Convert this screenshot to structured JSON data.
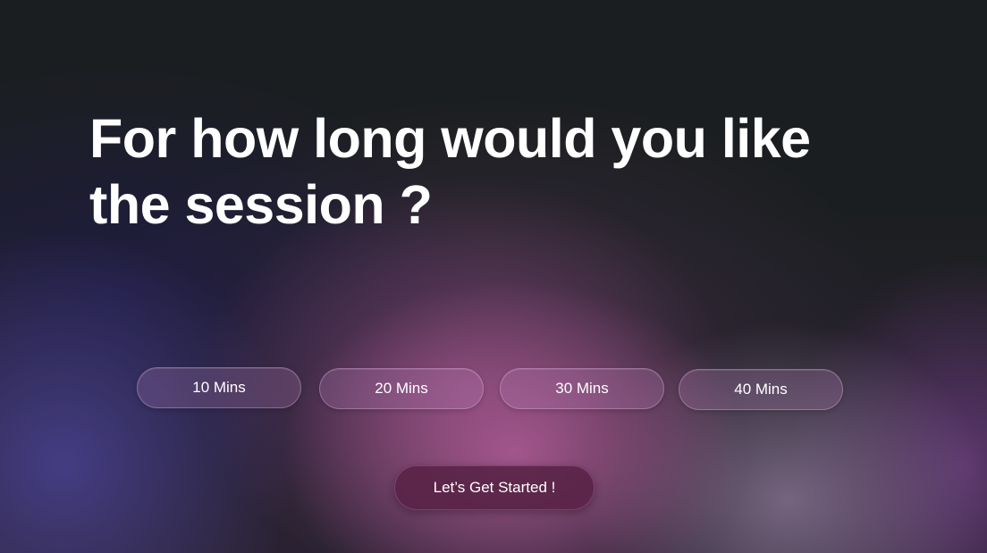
{
  "question": {
    "title": "For how long would you like the session ?"
  },
  "duration_options": [
    {
      "label": "10 Mins"
    },
    {
      "label": "20 Mins"
    },
    {
      "label": "30 Mins"
    },
    {
      "label": "40 Mins"
    }
  ],
  "cta": {
    "label": "Let’s Get Started !"
  },
  "colors": {
    "background": "#1b1e20",
    "text": "#ffffff",
    "option_fill": "rgba(200,140,200,0.22)",
    "cta_fill": "#582246",
    "glow_pink": "#b05c96",
    "glow_violet": "#48408c"
  }
}
